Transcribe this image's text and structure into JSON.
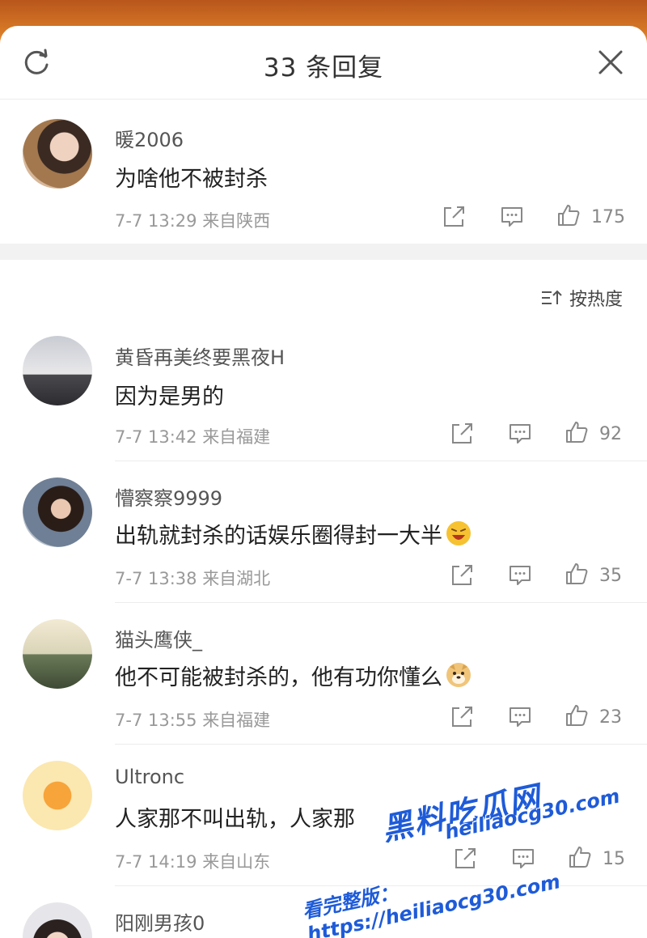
{
  "header": {
    "title": "33 条回复"
  },
  "root_comment": {
    "name": "暖2006",
    "text": "为啥他不被封杀",
    "time": "7-7 13:29",
    "location": "来自陕西",
    "likes": "175"
  },
  "sort_label": "按热度",
  "replies": [
    {
      "name": "黄昏再美终要黑夜H",
      "text": "因为是男的",
      "time": "7-7 13:42",
      "location": "来自福建",
      "likes": "92"
    },
    {
      "name": "懵察察9999",
      "text": "出轨就封杀的话娱乐圈得封一大半",
      "time": "7-7 13:38",
      "location": "来自湖北",
      "likes": "35"
    },
    {
      "name": "猫头鹰侠_",
      "text": "他不可能被封杀的，他有功你懂么",
      "time": "7-7 13:55",
      "location": "来自福建",
      "likes": "23"
    },
    {
      "name": "Ultronc",
      "text": "人家那不叫出轨，人家那",
      "time": "7-7 14:19",
      "location": "来自山东",
      "likes": "15"
    },
    {
      "name": "阳刚男孩0"
    }
  ],
  "watermark": {
    "brand": "黑料吃瓜网",
    "url": "heiliaocg30.com",
    "prompt": "看完整版：https://heiliaocg30.com"
  },
  "colors": {
    "accent_watermark": "#1e5bd8",
    "text_meta": "#999999"
  }
}
